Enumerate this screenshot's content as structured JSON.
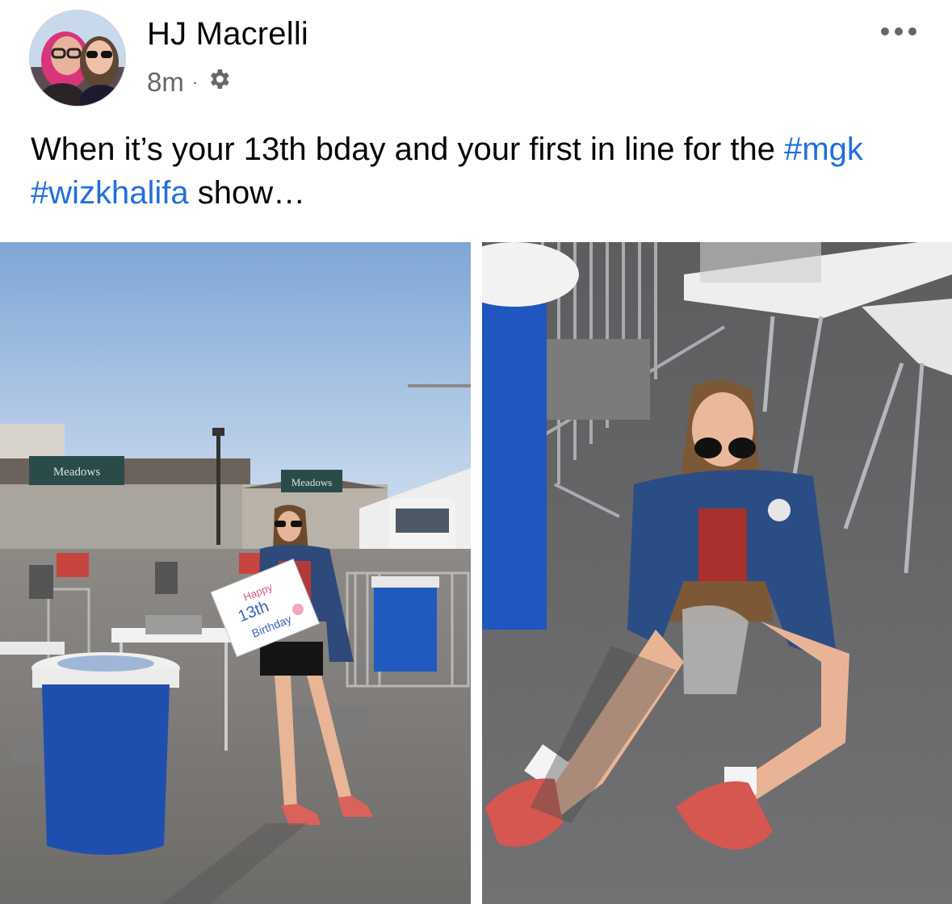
{
  "post": {
    "author": "HJ Macrelli",
    "timestamp": "8m",
    "separator": "·",
    "audience_icon": "gear-icon",
    "more_icon": "more-options-icon",
    "caption": {
      "part1": "When it’s your 13th bday and your first in line for the ",
      "tag1": "#mgk",
      "space": " ",
      "tag2": "#wizkhalifa",
      "part2": " show…"
    }
  },
  "photos": {
    "left": {
      "sign_main": "Meadows",
      "sign_secondary": "Meadows",
      "card_line1": "Happy",
      "card_line2": "13th",
      "card_line3": "Birthday"
    }
  },
  "colors": {
    "link": "#216fdb",
    "meta_text": "#65676b"
  }
}
